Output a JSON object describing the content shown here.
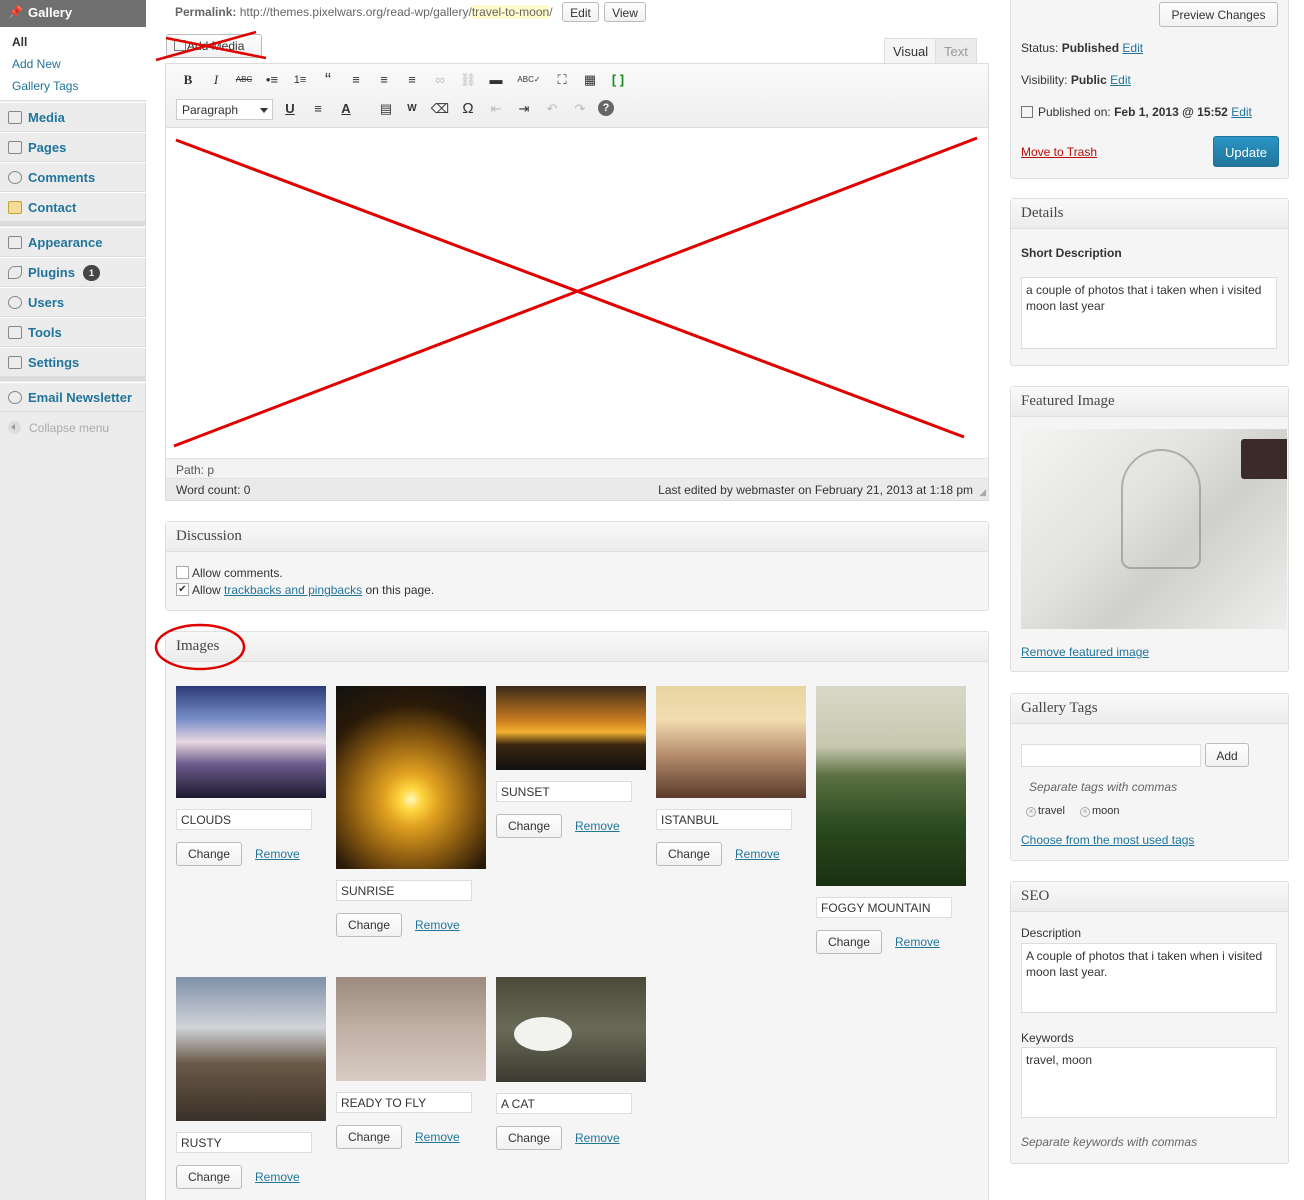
{
  "sidebar": {
    "gallery_label": "Gallery",
    "submenu": [
      "All",
      "Add New",
      "Gallery Tags"
    ],
    "items": [
      {
        "label": "Media",
        "icon": "media-icon"
      },
      {
        "label": "Pages",
        "icon": "pages-icon"
      },
      {
        "label": "Comments",
        "icon": "comments-icon"
      },
      {
        "label": "Contact",
        "icon": "contact-icon"
      },
      {
        "label": "Appearance",
        "icon": "appearance-icon"
      },
      {
        "label": "Plugins",
        "icon": "plugins-icon",
        "badge": "1"
      },
      {
        "label": "Users",
        "icon": "users-icon"
      },
      {
        "label": "Tools",
        "icon": "tools-icon"
      },
      {
        "label": "Settings",
        "icon": "settings-icon"
      },
      {
        "label": "Email Newsletter",
        "icon": "newsletter-icon"
      }
    ],
    "collapse": "Collapse menu"
  },
  "permalink": {
    "label": "Permalink:",
    "base": "http://themes.pixelwars.org/read-wp/gallery/",
    "slug": "travel-to-moon",
    "trail": "/",
    "edit": "Edit",
    "view": "View"
  },
  "editor": {
    "add_media": "Add Media",
    "tab_visual": "Visual",
    "tab_text": "Text",
    "format": "Paragraph",
    "path": "Path: p",
    "word_count": "Word count: 0",
    "last_edited": "Last edited by webmaster on February 21, 2013 at 1:18 pm",
    "toolbar_row1": [
      "B",
      "I",
      "ABC",
      "•≡",
      "1≡",
      "“",
      "≡",
      "≡",
      "≡",
      "∞",
      "⛓",
      "▬",
      "ABC✓",
      "⛶",
      "▦",
      "[ ]"
    ],
    "toolbar_row2": [
      "U",
      "≡",
      "A",
      "▤",
      "W",
      "⌫",
      "Ω",
      "⇤",
      "⇥",
      "↶",
      "↷",
      "?"
    ]
  },
  "discussion": {
    "title": "Discussion",
    "allow_comments": "Allow comments.",
    "allow_prefix": "Allow",
    "trackbacks_link": "trackbacks and pingbacks",
    "allow_suffix": "on this page."
  },
  "images": {
    "title": "Images",
    "change": "Change",
    "remove": "Remove",
    "items": [
      "CLOUDS",
      "SUNRISE",
      "SUNSET",
      "ISTANBUL",
      "FOGGY MOUNTAIN",
      "RUSTY",
      "READY TO FLY",
      "A CAT"
    ]
  },
  "publish": {
    "preview": "Preview Changes",
    "status_label": "Status:",
    "status_value": "Published",
    "visibility_label": "Visibility:",
    "visibility_value": "Public",
    "published_label": "Published on:",
    "published_value": "Feb 1, 2013 @ 15:52",
    "edit": "Edit",
    "trash": "Move to Trash",
    "update": "Update"
  },
  "details": {
    "title": "Details",
    "short_desc_label": "Short Description",
    "short_desc": "a couple of photos that i taken when i visited moon last year"
  },
  "featured": {
    "title": "Featured Image",
    "remove": "Remove featured image"
  },
  "tags": {
    "title": "Gallery Tags",
    "add": "Add",
    "hint": "Separate tags with commas",
    "list": [
      "travel",
      "moon"
    ],
    "choose": "Choose from the most used tags"
  },
  "seo": {
    "title": "SEO",
    "desc_label": "Description",
    "desc": "A couple of photos that i taken when i visited moon last year.",
    "kw_label": "Keywords",
    "kw": "travel, moon",
    "kw_hint": "Separate keywords with commas"
  },
  "colors": {
    "accent": "#21759b",
    "annotation": "#e00000",
    "sidebar_active": "#6f6f6f"
  }
}
